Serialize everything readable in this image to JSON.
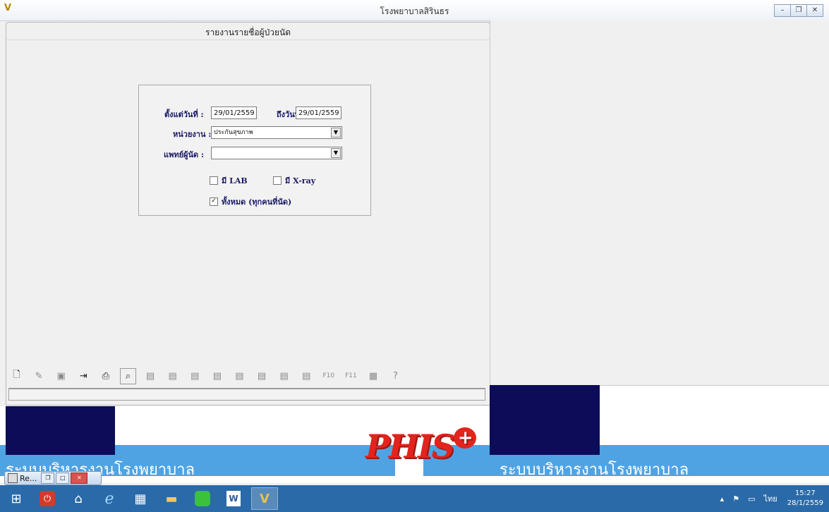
{
  "window": {
    "title": "โรงพยาบาลสิรินธร"
  },
  "dialog": {
    "title": "รายงานรายชื่อผู้ป่วยนัด",
    "from_label": "ตั้งแต่วันที่ :",
    "from_value": "29/01/2559",
    "to_label": "ถึงวันที่ :",
    "to_value": "29/01/2559",
    "unit_label": "หน่วยงาน :",
    "unit_value": "ประกันสุขภาพ",
    "doctor_label": "แพทย์ผู้นัด :",
    "doctor_value": "",
    "chk_lab": {
      "label": "มี LAB",
      "checked": false
    },
    "chk_xray": {
      "label": "มี X-ray",
      "checked": false
    },
    "chk_all": {
      "label": "ทั้งหมด (ทุกคนที่นัด)",
      "checked": true
    }
  },
  "toolbar": {
    "icons": [
      "new-document-icon",
      "edit-icon",
      "save-icon",
      "exit-door-icon",
      "print-icon",
      "print-preview-icon",
      "report-icon",
      "report-icon",
      "report-icon",
      "report-icon",
      "report-icon",
      "report-icon",
      "report-icon",
      "report-icon",
      "report-f10-icon",
      "report-f11-icon",
      "grid-icon",
      "help-icon"
    ],
    "help_glyph": "?",
    "f10": "F10",
    "f11": "F11"
  },
  "banner": {
    "left_text": "ระบบบริหารงานโรงพยาบาล",
    "right_text": "ระบบบริหารงานโรงพยาบาล",
    "logo_text": "PHIS",
    "logo_plus": "+"
  },
  "minimized": {
    "label": "Re..."
  },
  "taskbar": {
    "items": [
      "windows-start-icon",
      "power-icon",
      "home-icon",
      "internet-explorer-icon",
      "calculator-icon",
      "file-explorer-icon",
      "line-app-icon",
      "word-icon",
      "hospital-app-icon"
    ],
    "lang": "ไทย",
    "time": "15:27",
    "date": "28/1/2559"
  },
  "colors": {
    "navy": "#0c0c58",
    "sky": "#4fa3e3",
    "taskbar": "#2a6aa8",
    "logo_red": "#e3231d"
  }
}
